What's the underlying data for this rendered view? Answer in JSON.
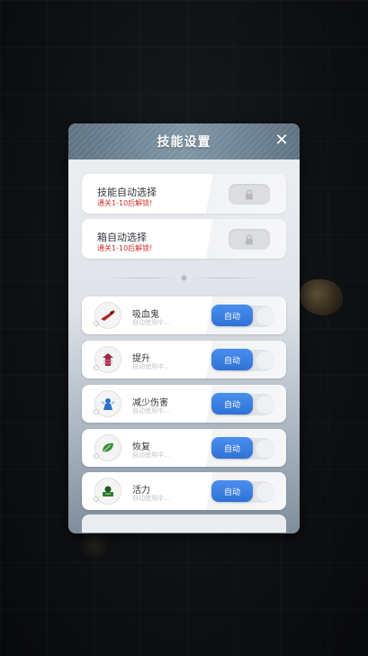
{
  "panel": {
    "title": "技能设置",
    "close_icon": "close-icon"
  },
  "auto_select": [
    {
      "title": "技能自动选择",
      "hint": "通关1-10后解锁!",
      "icon": "lock-icon"
    },
    {
      "title": "箱自动选择",
      "hint": "通关1-10后解锁!",
      "icon": "lock-icon"
    }
  ],
  "skills": [
    {
      "name": "吸血鬼",
      "status": "自动使用中…",
      "toggle_label": "自动",
      "icon": "vampire-skill-icon",
      "color": "#b3262b"
    },
    {
      "name": "提升",
      "status": "自动使用中…",
      "toggle_label": "自动",
      "icon": "boost-skill-icon",
      "color": "#9a2a4a"
    },
    {
      "name": "减少伤害",
      "status": "自动使用中…",
      "toggle_label": "自动",
      "icon": "damage-reduction-skill-icon",
      "color": "#2a73c9"
    },
    {
      "name": "恢复",
      "status": "自动使用中…",
      "toggle_label": "自动",
      "icon": "recovery-skill-icon",
      "color": "#3b8f3b"
    },
    {
      "name": "活力",
      "status": "自动使用中…",
      "toggle_label": "自动",
      "icon": "vitality-skill-icon",
      "color": "#2f7a2f"
    }
  ],
  "colors": {
    "accent": "#2f72d6",
    "hint_red": "#d0312d"
  }
}
